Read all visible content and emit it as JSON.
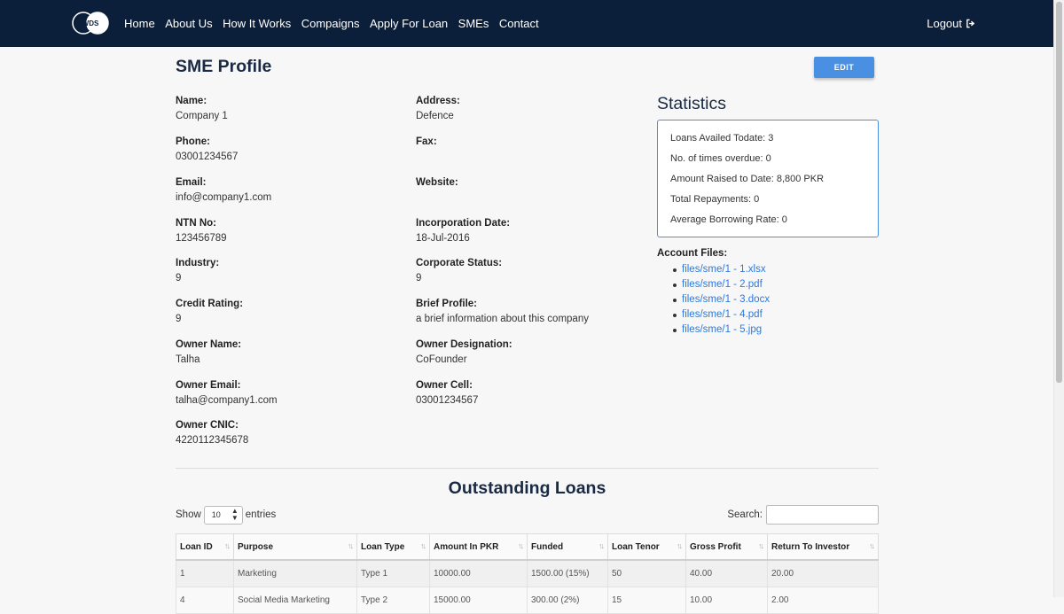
{
  "nav": {
    "logo_text": "WDS",
    "links": [
      "Home",
      "About Us",
      "How It Works",
      "Compaigns",
      "Apply For Loan",
      "SMEs",
      "Contact"
    ],
    "logout": "Logout"
  },
  "profile": {
    "title": "SME Profile",
    "edit_label": "EDIT",
    "fields": {
      "name": {
        "label": "Name:",
        "value": "Company 1"
      },
      "address": {
        "label": "Address:",
        "value": "Defence"
      },
      "phone": {
        "label": "Phone:",
        "value": "03001234567"
      },
      "fax": {
        "label": "Fax:",
        "value": ""
      },
      "email": {
        "label": "Email:",
        "value": "info@company1.com"
      },
      "website": {
        "label": "Website:",
        "value": ""
      },
      "ntn": {
        "label": "NTN No:",
        "value": "123456789"
      },
      "incorporation": {
        "label": "Incorporation Date:",
        "value": "18-Jul-2016"
      },
      "industry": {
        "label": "Industry:",
        "value": "9"
      },
      "corporate_status": {
        "label": "Corporate Status:",
        "value": "9"
      },
      "credit_rating": {
        "label": "Credit Rating:",
        "value": "9"
      },
      "brief_profile": {
        "label": "Brief Profile:",
        "value": "a brief information about this company"
      },
      "owner_name": {
        "label": "Owner Name:",
        "value": "Talha"
      },
      "owner_designation": {
        "label": "Owner Designation:",
        "value": "CoFounder"
      },
      "owner_email": {
        "label": "Owner Email:",
        "value": "talha@company1.com"
      },
      "owner_cell": {
        "label": "Owner Cell:",
        "value": "03001234567"
      },
      "owner_cnic": {
        "label": "Owner CNIC:",
        "value": "4220112345678"
      }
    }
  },
  "statistics": {
    "title": "Statistics",
    "rows": [
      "Loans Availed Todate: 3",
      "No. of times overdue: 0",
      "Amount Raised to Date: 8,800 PKR",
      "Total Repayments: 0",
      "Average Borrowing Rate: 0"
    ]
  },
  "files": {
    "label": "Account Files:",
    "items": [
      "files/sme/1 - 1.xlsx",
      "files/sme/1 - 2.pdf",
      "files/sme/1 - 3.docx",
      "files/sme/1 - 4.pdf",
      "files/sme/1 - 5.jpg"
    ]
  },
  "loans": {
    "title": "Outstanding Loans",
    "show_label": "Show",
    "entries_value": "10",
    "entries_label": "entries",
    "search_label": "Search:",
    "columns": [
      "Loan ID",
      "Purpose",
      "Loan Type",
      "Amount In PKR",
      "Funded",
      "Loan Tenor",
      "Gross Profit",
      "Return To Investor"
    ],
    "rows": [
      [
        "1",
        "Marketing",
        "Type 1",
        "10000.00",
        "1500.00 (15%)",
        "50",
        "40.00",
        "20.00"
      ],
      [
        "4",
        "Social Media Marketing",
        "Type 2",
        "15000.00",
        "300.00 (2%)",
        "15",
        "10.00",
        "2.00"
      ]
    ]
  }
}
